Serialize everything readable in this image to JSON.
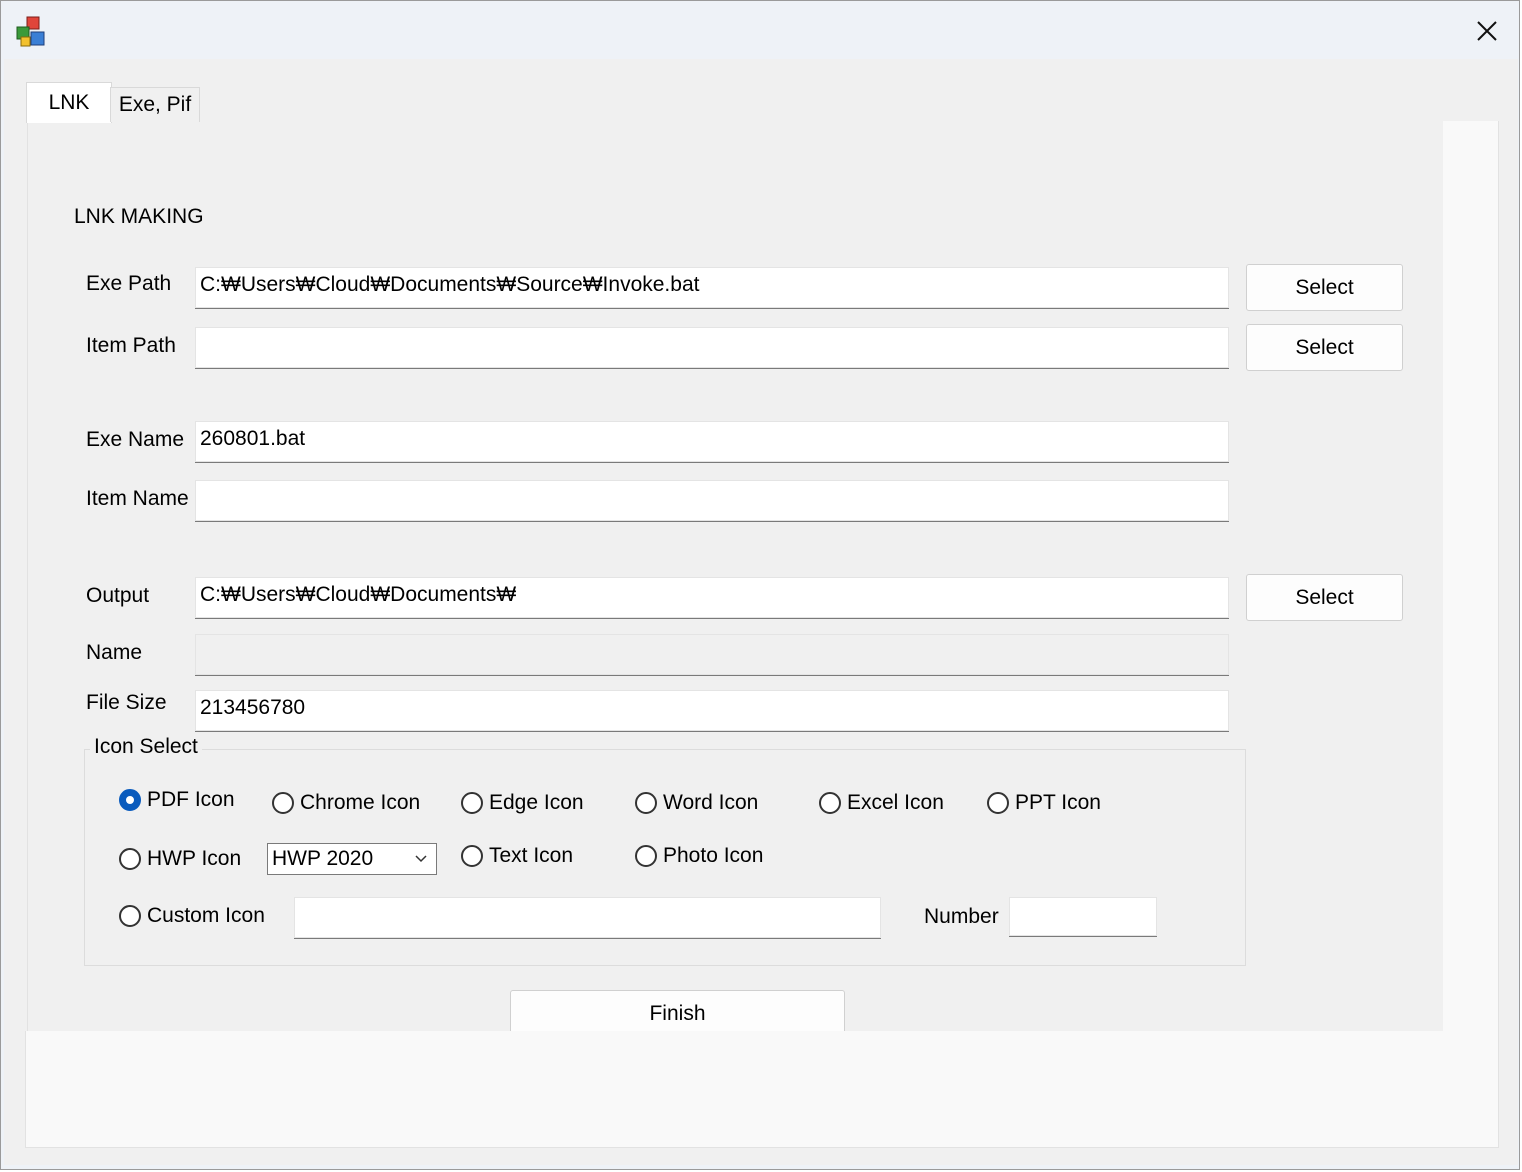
{
  "tabs": [
    "LNK",
    "Exe, Pif"
  ],
  "section_title": "LNK MAKING",
  "fields": {
    "exe_path": {
      "label": "Exe Path",
      "value": "C:₩Users₩Cloud₩Documents₩Source₩Invoke.bat"
    },
    "item_path": {
      "label": "Item Path",
      "value": ""
    },
    "exe_name": {
      "label": "Exe Name",
      "value": "260801.bat"
    },
    "item_name": {
      "label": "Item Name",
      "value": ""
    },
    "output": {
      "label": "Output",
      "value": "C:₩Users₩Cloud₩Documents₩"
    },
    "name": {
      "label": "Name",
      "value": ""
    },
    "file_size": {
      "label": "File Size",
      "value": "213456780"
    }
  },
  "select_label": "Select",
  "icon_group": {
    "title": "Icon Select",
    "options": {
      "pdf": "PDF Icon",
      "chrome": "Chrome Icon",
      "edge": "Edge Icon",
      "word": "Word Icon",
      "excel": "Excel Icon",
      "ppt": "PPT Icon",
      "hwp": "HWP Icon",
      "text": "Text Icon",
      "photo": "Photo Icon",
      "custom": "Custom Icon"
    },
    "selected": "pdf",
    "hwp_version": "HWP 2020",
    "custom_path": "",
    "number_label": "Number",
    "number_value": ""
  },
  "finish_label": "Finish",
  "colors": {
    "accent": "#0a5bbd"
  }
}
